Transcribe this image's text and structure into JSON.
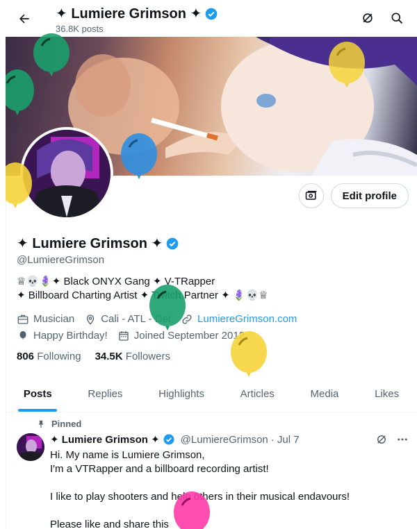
{
  "header": {
    "back_icon": "arrow-left-icon",
    "title": "✦ Lumiere Grimson ✦",
    "posts_count": "36.8K posts",
    "icons": [
      "grok-slash-icon",
      "search-icon"
    ]
  },
  "profile": {
    "display_name": "✦ Lumiere Grimson ✦",
    "handle": "@LumiereGrimson",
    "verified": true,
    "edit_profile_label": "Edit profile",
    "bio_line1": "♕💀🪻✦ Black ONYX Gang ✦ V-TRapper",
    "bio_line2": "✦ Billboard Charting Artist ✦ Twitch Partner ✦ 🪻💀♕",
    "category": "Musician",
    "location": "Cali - ATL - Det",
    "website": "LumiereGrimson.com",
    "birthday": "Happy Birthday!",
    "joined": "Joined September 2012",
    "following_count": "806",
    "following_label": "Following",
    "followers_count": "34.5K",
    "followers_label": "Followers"
  },
  "tabs": [
    "Posts",
    "Replies",
    "Highlights",
    "Articles",
    "Media",
    "Likes"
  ],
  "active_tab": "Posts",
  "pinned_post": {
    "pinned_label": "Pinned",
    "author": "✦ Lumiere Grimson ✦",
    "handle": "@LumiereGrimson",
    "date": "· Jul 7",
    "lines": [
      "Hi.  My name is Lumiere Grimson,",
      "I'm a VTRapper and a billboard recording artist!",
      "",
      "I like to play shooters and help others in their musical endavours!",
      "",
      "Please like and share this"
    ]
  },
  "colors": {
    "accent": "#1d9bf0",
    "text": "#0f1419",
    "muted": "#536471",
    "balloon_green": "#1a9e6a",
    "balloon_yellow": "#f5d33a",
    "balloon_blue": "#2f8fe0",
    "balloon_pink": "#ff3aa8"
  }
}
